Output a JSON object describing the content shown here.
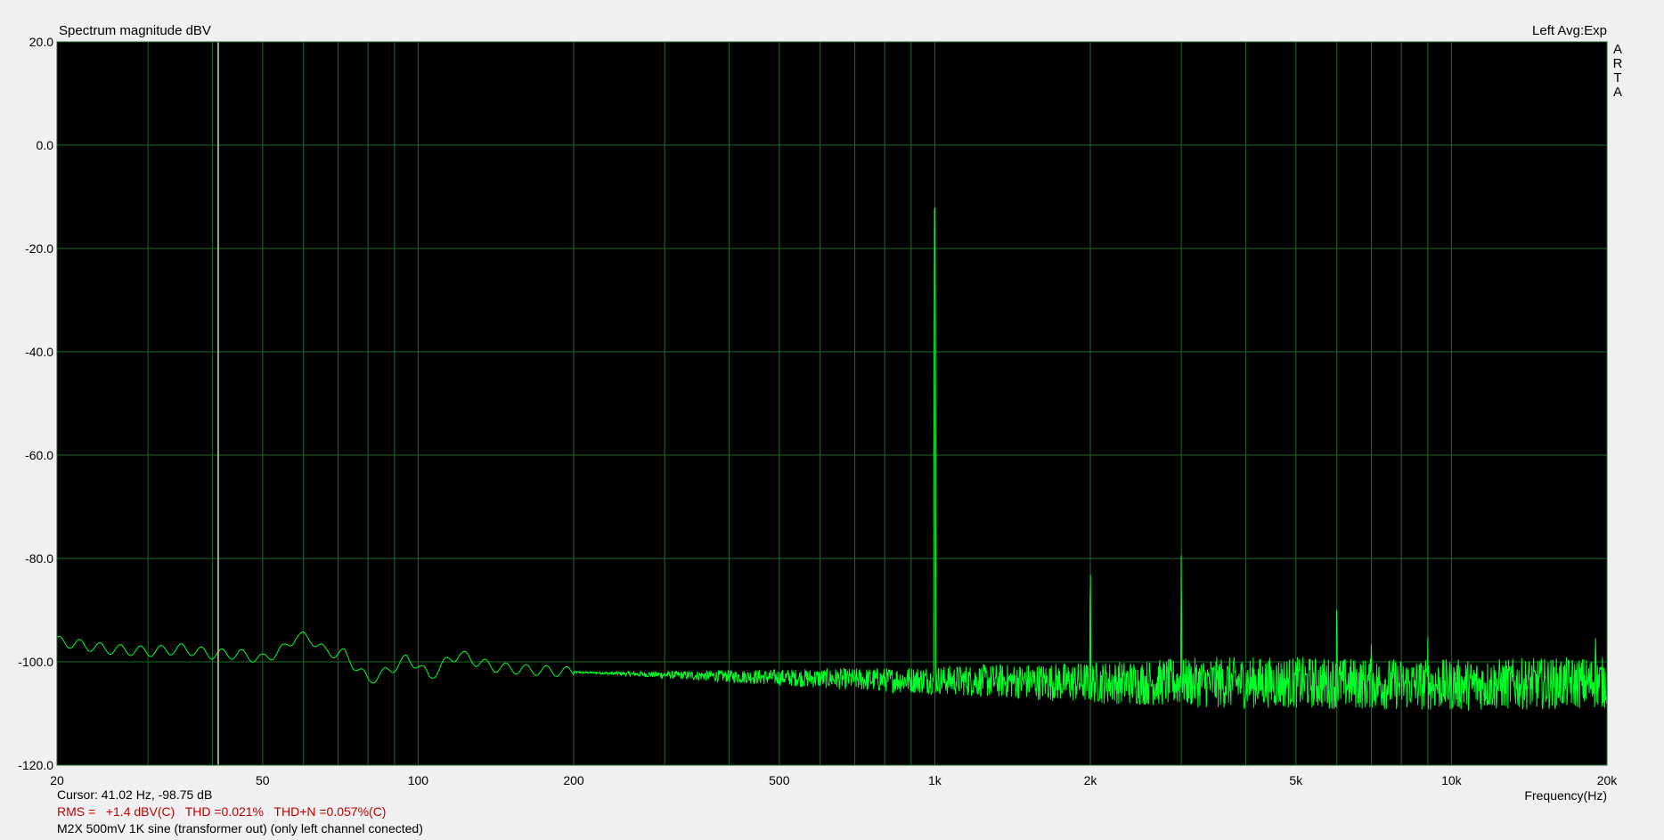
{
  "header": {
    "title": "Spectrum magnitude dBV",
    "channel": "Left  Avg:Exp",
    "brand_letters": [
      "A",
      "R",
      "T",
      "A"
    ]
  },
  "status": {
    "cursor": "Cursor: 41.02 Hz, -98.75 dB",
    "measurement": "RMS =   +1.4 dBV(C)   THD =0.021%   THD+N =0.057%(C)",
    "description": "M2X 500mV 1K sine (transformer out) (only left channel conected)"
  },
  "colors": {
    "plot_background": "#000000",
    "grid": "#1f6a2b",
    "trace": "#00ff2a",
    "cursor": "#d9d29a",
    "measurement_text": "#c00000"
  },
  "chart_data": {
    "type": "line",
    "title": "Spectrum magnitude dBV",
    "xlabel": "Frequency(Hz)",
    "ylabel": "",
    "x_scale": "log",
    "xlim": [
      20,
      20000
    ],
    "ylim": [
      -120,
      20
    ],
    "grid": true,
    "x_ticks": [
      {
        "value": 20,
        "label": "20"
      },
      {
        "value": 50,
        "label": "50"
      },
      {
        "value": 100,
        "label": "100"
      },
      {
        "value": 200,
        "label": "200"
      },
      {
        "value": 500,
        "label": "500"
      },
      {
        "value": 1000,
        "label": "1k"
      },
      {
        "value": 2000,
        "label": "2k"
      },
      {
        "value": 5000,
        "label": "5k"
      },
      {
        "value": 10000,
        "label": "10k"
      },
      {
        "value": 20000,
        "label": "20k"
      }
    ],
    "y_ticks": [
      {
        "value": 20,
        "label": "20.0"
      },
      {
        "value": 0,
        "label": "0.0"
      },
      {
        "value": -20,
        "label": "-20.0"
      },
      {
        "value": -40,
        "label": "-40.0"
      },
      {
        "value": -60,
        "label": "-60.0"
      },
      {
        "value": -80,
        "label": "-80.0"
      },
      {
        "value": -100,
        "label": "-100.0"
      },
      {
        "value": -120,
        "label": "-120.0"
      }
    ],
    "cursor": {
      "x": 41.02,
      "y": -98.75
    },
    "noise_floor_points": [
      [
        20,
        -96
      ],
      [
        25,
        -97.5
      ],
      [
        30,
        -98
      ],
      [
        35,
        -97.5
      ],
      [
        40,
        -98.5
      ],
      [
        45,
        -98.5
      ],
      [
        50,
        -99.5
      ],
      [
        55,
        -97.5
      ],
      [
        58,
        -95
      ],
      [
        62,
        -95.5
      ],
      [
        66,
        -98
      ],
      [
        72,
        -98.5
      ],
      [
        80,
        -103.5
      ],
      [
        85,
        -102.5
      ],
      [
        95,
        -99.5
      ],
      [
        100,
        -100.5
      ],
      [
        105,
        -103
      ],
      [
        115,
        -99.5
      ],
      [
        120,
        -98.5
      ],
      [
        130,
        -100
      ],
      [
        140,
        -101
      ],
      [
        160,
        -101.5
      ],
      [
        200,
        -102
      ],
      [
        300,
        -102.5
      ],
      [
        500,
        -103
      ],
      [
        800,
        -103.5
      ],
      [
        1000,
        -103.5
      ],
      [
        2000,
        -104
      ],
      [
        5000,
        -104
      ],
      [
        10000,
        -104.5
      ],
      [
        20000,
        -104
      ]
    ],
    "peaks": [
      {
        "x": 1000,
        "y": 0.8
      },
      {
        "x": 2000,
        "y": -77
      },
      {
        "x": 3000,
        "y": -75
      },
      {
        "x": 6000,
        "y": -85
      },
      {
        "x": 7000,
        "y": -94
      },
      {
        "x": 9000,
        "y": -95
      },
      {
        "x": 19000,
        "y": -93
      }
    ]
  }
}
